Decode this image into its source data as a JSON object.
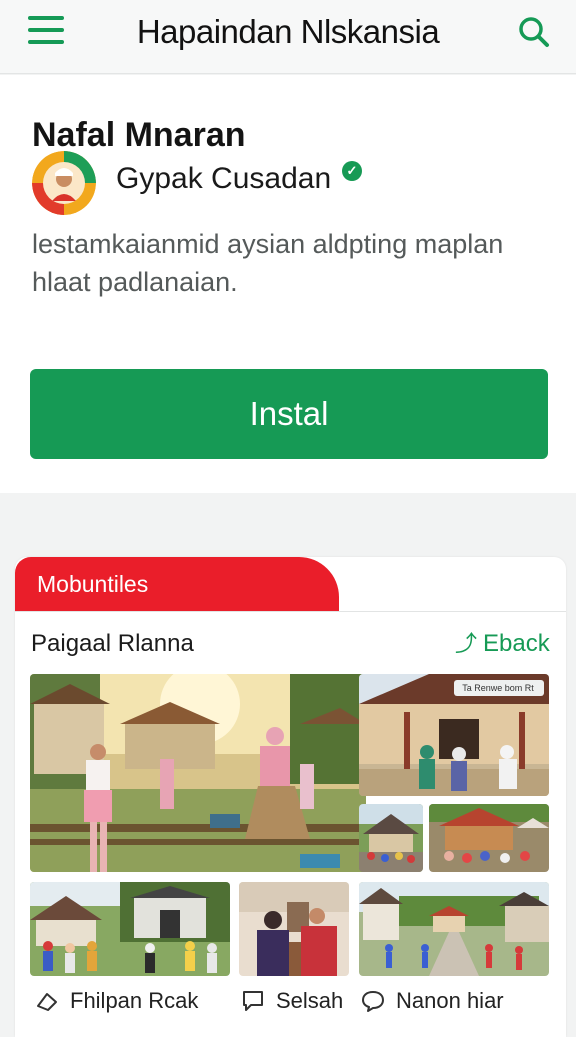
{
  "header": {
    "title": "Hapaindan Nlskansia"
  },
  "app": {
    "name": "Nafal Mnaran",
    "developer": "Gypak Cusadan",
    "verified_mark": "✓",
    "description": "lestamkaianmid aysian aldpting maplan hlaat padlanaian.",
    "install_label": "Instal"
  },
  "media": {
    "tab_label": "Mobuntiles",
    "section_title": "Paigaal Rlanna",
    "back_label": "Eback",
    "photo_badge": "Ta Renwe bom Rt",
    "photos": [
      "village-courtyard-scene",
      "house-porch-people",
      "pavilion-crowd",
      "market-stalls",
      "village-gathering",
      "indoor-meeting",
      "village-street"
    ]
  },
  "actions": [
    {
      "label": "Fhilpan Rcak",
      "icon": "share-icon"
    },
    {
      "label": "Selsah",
      "icon": "comment-icon"
    },
    {
      "label": "Nanon hiar",
      "icon": "chat-icon"
    }
  ],
  "colors": {
    "accent_green": "#169a55",
    "accent_red": "#ea1e2a"
  }
}
